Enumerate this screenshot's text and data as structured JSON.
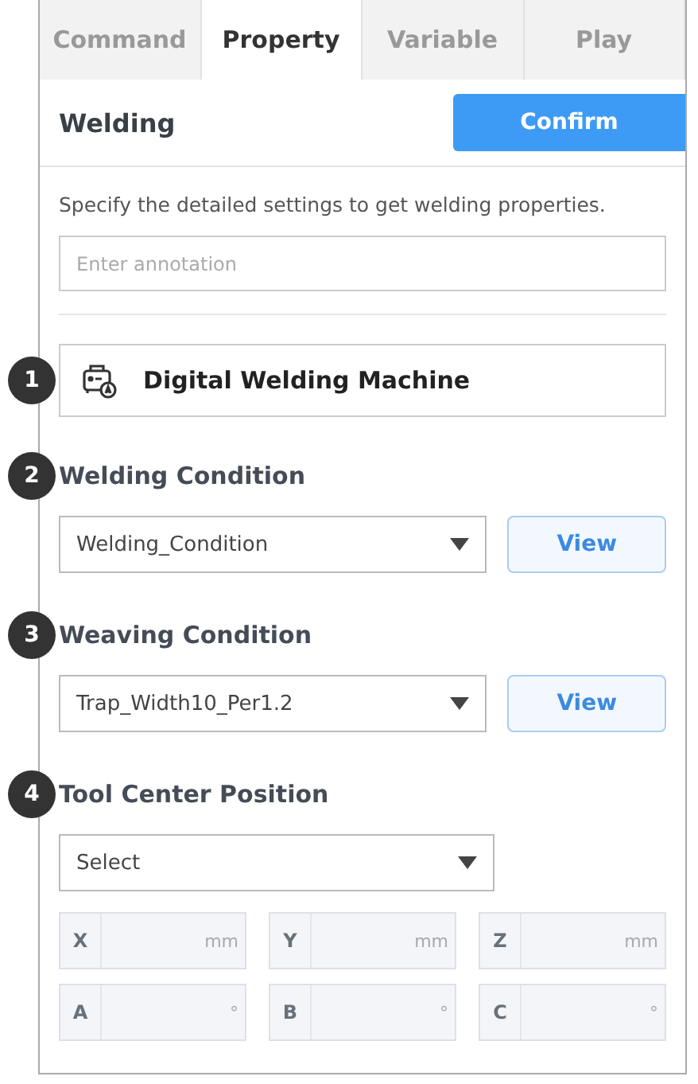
{
  "tabs": [
    {
      "label": "Command",
      "selected": false
    },
    {
      "label": "Property",
      "selected": true
    },
    {
      "label": "Variable",
      "selected": false
    },
    {
      "label": "Play",
      "selected": false
    }
  ],
  "header": {
    "title": "Welding",
    "confirm_button": "Confirm"
  },
  "description": "Specify the detailed settings to get welding properties.",
  "annotation": {
    "placeholder": "Enter annotation"
  },
  "machine": {
    "marker": "1",
    "name": "Digital Welding Machine"
  },
  "sections": [
    {
      "marker": "2",
      "label": "Welding Condition",
      "select": "Welding_Condition",
      "button": "View"
    },
    {
      "marker": "3",
      "label": "Weaving Condition",
      "select": "Trap_Width10_Per1.2",
      "button": "View"
    }
  ],
  "tool_center": {
    "marker": "4",
    "label": "Tool Center Position",
    "select": "Select",
    "coords": [
      {
        "axis": "X",
        "unit": "mm"
      },
      {
        "axis": "Y",
        "unit": "mm"
      },
      {
        "axis": "Z",
        "unit": "mm"
      },
      {
        "axis": "A",
        "unit": "°"
      },
      {
        "axis": "B",
        "unit": "°"
      },
      {
        "axis": "C",
        "unit": "°"
      }
    ]
  }
}
